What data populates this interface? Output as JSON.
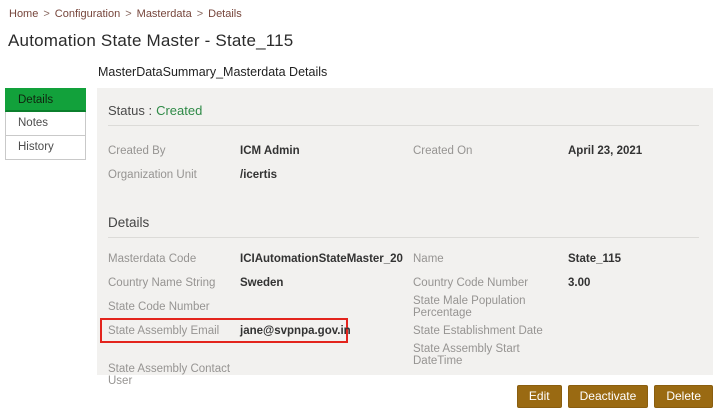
{
  "breadcrumb": {
    "separator": ">",
    "items": [
      "Home",
      "Configuration",
      "Masterdata",
      "Details"
    ]
  },
  "page_title": "Automation State Master - State_115",
  "sidebar": {
    "tabs": [
      {
        "label": "Details",
        "active": true
      },
      {
        "label": "Notes",
        "active": false
      },
      {
        "label": "History",
        "active": false
      }
    ]
  },
  "panel": {
    "tab_label": "MasterDataSummary_Masterdata Details",
    "status": {
      "label": "Status :",
      "value": "Created"
    },
    "summary": {
      "fields": [
        {
          "label": "Created By",
          "value": "ICM Admin"
        },
        {
          "label": "Created On",
          "value": "April 23, 2021"
        },
        {
          "label": "Organization Unit",
          "value": "/icertis"
        }
      ]
    },
    "details": {
      "title": "Details",
      "left": [
        {
          "label": "Masterdata Code",
          "value": "ICIAutomationStateMaster_20"
        },
        {
          "label": "Country Name String",
          "value": "Sweden"
        },
        {
          "label": "State Code Number",
          "value": ""
        },
        {
          "label": "State Assembly Email",
          "value": "jane@svpnpa.gov.in",
          "highlighted": true
        },
        {
          "label": "State Assembly Contact User",
          "value": ""
        }
      ],
      "right": [
        {
          "label": "Name",
          "value": "State_115"
        },
        {
          "label": "Country Code Number",
          "value": "3.00"
        },
        {
          "label": "State Male Population Percentage",
          "value": ""
        },
        {
          "label": "State Establishment Date",
          "value": ""
        },
        {
          "label": "State Assembly Start DateTime",
          "value": ""
        }
      ]
    }
  },
  "actions": {
    "edit": "Edit",
    "deactivate": "Deactivate",
    "delete": "Delete"
  },
  "colors": {
    "accent_green": "#12A13B",
    "status_green": "#2F8A47",
    "button_gold": "#9A6A12",
    "highlight_red": "#E3241D",
    "breadcrumb_link": "#76453B"
  }
}
